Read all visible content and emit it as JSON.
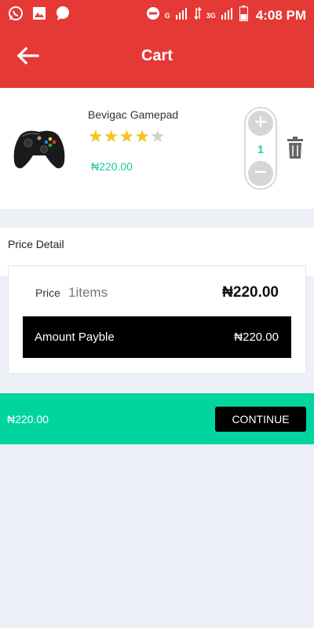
{
  "status_bar": {
    "time": "4:08 PM",
    "network_g": "G",
    "network_3g": "3G",
    "icons": [
      "whatsapp-icon",
      "image-icon",
      "chat-icon",
      "do-not-disturb-icon",
      "signal-icon",
      "battery-icon"
    ]
  },
  "app_bar": {
    "title": "Cart",
    "back_icon": "arrow-left-icon"
  },
  "cart": {
    "items": [
      {
        "name": "Bevigac Gamepad",
        "rating": 4,
        "rating_max": 5,
        "price": "₦220.00",
        "quantity": "1"
      }
    ]
  },
  "price_detail": {
    "heading": "Price Detail",
    "price_label": "Price",
    "items_count": "1items",
    "price_value": "₦220.00",
    "amount_label": "Amount Payble",
    "amount_value": "₦220.00"
  },
  "checkout": {
    "total": "₦220.00",
    "continue_label": "CONTINUE"
  },
  "colors": {
    "primary": "#e53935",
    "accent": "#00d5a0",
    "price_green": "#1ec9a0",
    "star": "#f5c518"
  }
}
